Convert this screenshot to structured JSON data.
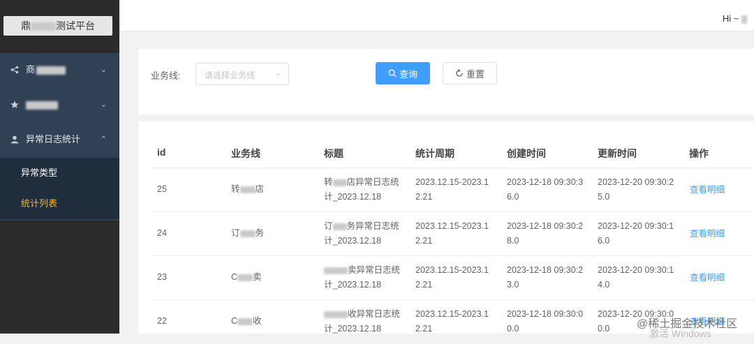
{
  "sidebar": {
    "logo": {
      "prefix": "鼎",
      "suffix": "测试平台"
    },
    "menu": [
      {
        "label": "商",
        "icon": "share-icon"
      },
      {
        "label": "",
        "icon": "star-icon"
      },
      {
        "label": "异常日志统计",
        "icon": "user-icon"
      }
    ],
    "submenu": [
      {
        "label": "异常类型"
      },
      {
        "label": "统计列表"
      }
    ]
  },
  "header": {
    "greeting": "Hi ~ "
  },
  "filter": {
    "label": "业务线:",
    "select_placeholder": "请选择业务线",
    "query_label": "查询",
    "reset_label": "重置"
  },
  "table": {
    "columns": [
      "id",
      "业务线",
      "标题",
      "统计周期",
      "创建时间",
      "更新时间",
      "操作"
    ],
    "rows": [
      {
        "id": "25",
        "biz_a": "转",
        "biz_b": "店",
        "title_a": "转",
        "title_b": "店异常日志统",
        "title_c": "计_2023.12.18",
        "period_1": "2023.12.15-2023.1",
        "period_2": "2.21",
        "created_1": "2023-12-18 09:30:3",
        "created_2": "6.0",
        "updated_1": "2023-12-20 09:30:2",
        "updated_2": "5.0",
        "action": "查看明细"
      },
      {
        "id": "24",
        "biz_a": "订",
        "biz_b": "务",
        "title_a": "订",
        "title_b": "务异常日志统",
        "title_c": "计_2023.12.18",
        "period_1": "2023.12.15-2023.1",
        "period_2": "2.21",
        "created_1": "2023-12-18 09:30:2",
        "created_2": "8.0",
        "updated_1": "2023-12-20 09:30:1",
        "updated_2": "6.0",
        "action": "查看明细"
      },
      {
        "id": "23",
        "biz_a": "C",
        "biz_b": "卖",
        "title_a": "",
        "title_b": "卖异常日志统",
        "title_c": "计_2023.12.18",
        "period_1": "2023.12.15-2023.1",
        "period_2": "2.21",
        "created_1": "2023-12-18 09:30:2",
        "created_2": "3.0",
        "updated_1": "2023-12-20 09:30:1",
        "updated_2": "4.0",
        "action": "查看明细"
      },
      {
        "id": "22",
        "biz_a": "C",
        "biz_b": "收",
        "title_a": "",
        "title_b": "收异常日志统",
        "title_c": "计_2023.12.18",
        "period_1": "2023.12.15-2023.1",
        "period_2": "2.21",
        "created_1": "2023-12-18 09:30:0",
        "created_2": "0.0",
        "updated_1": "2023-12-20 09:30:0",
        "updated_2": "0.0",
        "action": "查看明细"
      }
    ]
  },
  "watermark": {
    "text": "@稀土掘金技术社区",
    "activate": "激活 Windows"
  },
  "colors": {
    "primary": "#409eff",
    "sidebar_bg": "#304156",
    "active_submenu": "#f2b53a"
  }
}
